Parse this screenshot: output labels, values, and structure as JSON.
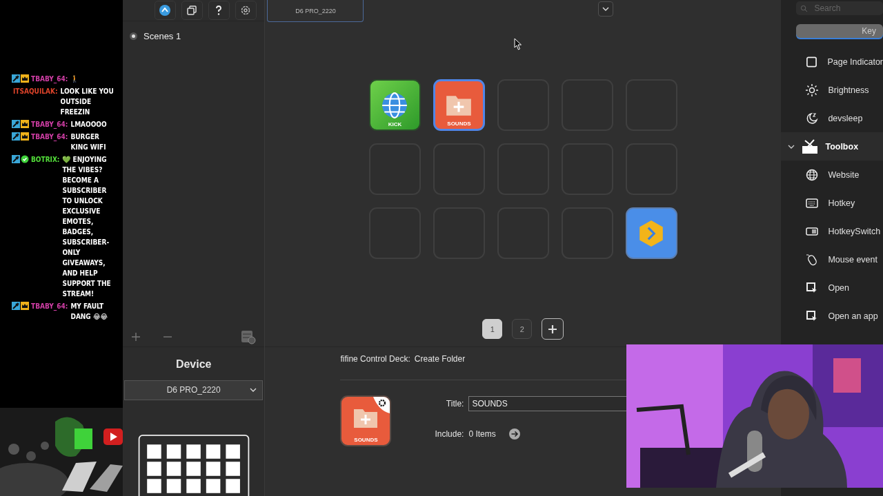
{
  "chat": [
    {
      "kind": "subscriber",
      "user": "TBABY_64:",
      "color": "#d43fa8",
      "text": "🚶"
    },
    {
      "kind": "plain",
      "user": "ITSAQUILAK:",
      "color": "#e0442a",
      "text": "LOOK LIKE YOU OUTSIDE FREEZIN"
    },
    {
      "kind": "subscriber",
      "user": "TBABY_64:",
      "color": "#d43fa8",
      "text": "LMAOOOO"
    },
    {
      "kind": "subscriber",
      "user": "TBABY_64:",
      "color": "#d43fa8",
      "text": "BURGER KING WIFI"
    },
    {
      "kind": "bot",
      "user": "BOTRIX:",
      "color": "#53e03a",
      "text": "💚 ENJOYING THE VIBES? BECOME A SUBSCRIBER TO UNLOCK EXCLUSIVE EMOTES, BADGES, SUBSCRIBER-ONLY GIVEAWAYS, AND HELP SUPPORT THE STREAM!"
    },
    {
      "kind": "subscriber",
      "user": "TBABY_64:",
      "color": "#d43fa8",
      "text": "MY FAULT DANG 😂😂"
    }
  ],
  "scenes": [
    {
      "label": "Scenes 1",
      "selected": true
    }
  ],
  "device_panel": {
    "title": "Device",
    "device": "D6 PRO_2220"
  },
  "device_tab": {
    "label": "D6 PRO_2220",
    "selected": true
  },
  "keys": [
    {
      "kind": "website",
      "label": "KICK",
      "selected": false
    },
    {
      "kind": "folder",
      "label": "SOUNDS",
      "selected": true
    },
    {
      "kind": "empty",
      "selected": false
    },
    {
      "kind": "empty",
      "selected": false
    },
    {
      "kind": "empty",
      "selected": false
    },
    {
      "kind": "empty",
      "selected": false
    },
    {
      "kind": "empty",
      "selected": false
    },
    {
      "kind": "empty",
      "selected": false
    },
    {
      "kind": "empty",
      "selected": false
    },
    {
      "kind": "empty",
      "selected": false
    },
    {
      "kind": "empty",
      "selected": false
    },
    {
      "kind": "empty",
      "selected": false
    },
    {
      "kind": "empty",
      "selected": false
    },
    {
      "kind": "empty",
      "selected": false
    },
    {
      "kind": "next",
      "selected": false
    }
  ],
  "pages": [
    {
      "label": "1",
      "selected": true
    },
    {
      "label": "2",
      "selected": false
    }
  ],
  "detail": {
    "app": "fifine Control Deck:",
    "action": "Create Folder",
    "title_label": "Title:",
    "title_value": "SOUNDS",
    "include_label": "Include:",
    "include_value": "0 Items",
    "preview_label": "SOUNDS"
  },
  "right_panel": {
    "search": {
      "placeholder": "Search"
    },
    "tab": {
      "label": "Key",
      "selected": true
    },
    "items": [
      {
        "kind": "square",
        "label": "Page Indicator"
      },
      {
        "kind": "sun",
        "label": "Brightness"
      },
      {
        "kind": "moon",
        "label": "devsleep"
      },
      {
        "kind": "toolbox",
        "label": "Toolbox",
        "expanded": true,
        "children": [
          {
            "kind": "globe",
            "label": "Website"
          },
          {
            "kind": "keyboard",
            "label": "Hotkey"
          },
          {
            "kind": "switch",
            "label": "HotkeySwitch"
          },
          {
            "kind": "mouse",
            "label": "Mouse event"
          },
          {
            "kind": "open",
            "label": "Open"
          },
          {
            "kind": "open",
            "label": "Open an app"
          }
        ]
      }
    ]
  }
}
